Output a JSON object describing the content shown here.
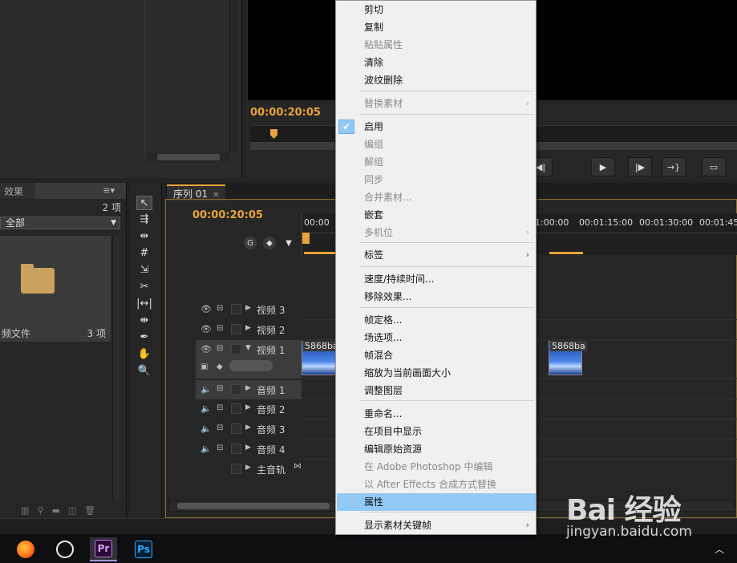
{
  "effects_panel": {
    "tab": "效果",
    "count": "2 项",
    "filter": "全部",
    "bin_name": "频文件",
    "bin_count": "3 项"
  },
  "monitor": {
    "timecode": "00:00:20:05"
  },
  "timeline": {
    "tab": "序列 01",
    "timecode": "00:00:20:05",
    "ruler_ticks": [
      "00:00",
      "1:00:00",
      "00:01:15:00",
      "00:01:30:00",
      "00:01:45:"
    ],
    "tracks": {
      "v3": "视频 3",
      "v2": "视频 2",
      "v1": "视频 1",
      "a1": "音频 1",
      "a2": "音频 2",
      "a3": "音频 3",
      "a4": "音频 4",
      "master": "主音轨"
    },
    "clips": [
      "5868ba",
      "5868ba"
    ]
  },
  "context_menu": {
    "items": [
      {
        "label": "剪切",
        "enabled": true
      },
      {
        "label": "复制",
        "enabled": true
      },
      {
        "label": "粘贴属性",
        "enabled": false
      },
      {
        "label": "清除",
        "enabled": true
      },
      {
        "label": "波纹删除",
        "enabled": true
      },
      {
        "label": "替换素材",
        "enabled": false,
        "submenu": true
      },
      {
        "label": "启用",
        "enabled": true,
        "checked": true
      },
      {
        "label": "编组",
        "enabled": false
      },
      {
        "label": "解组",
        "enabled": false
      },
      {
        "label": "同步",
        "enabled": false
      },
      {
        "label": "合并素材...",
        "enabled": false
      },
      {
        "label": "嵌套",
        "enabled": true
      },
      {
        "label": "多机位",
        "enabled": false,
        "submenu": true
      },
      {
        "label": "标签",
        "enabled": true,
        "submenu": true
      },
      {
        "label": "速度/持续时间...",
        "enabled": true
      },
      {
        "label": "移除效果...",
        "enabled": true
      },
      {
        "label": "帧定格...",
        "enabled": true
      },
      {
        "label": "场选项...",
        "enabled": true
      },
      {
        "label": "帧混合",
        "enabled": true
      },
      {
        "label": "缩放为当前画面大小",
        "enabled": true
      },
      {
        "label": "调整图层",
        "enabled": true
      },
      {
        "label": "重命名...",
        "enabled": true
      },
      {
        "label": "在项目中显示",
        "enabled": true
      },
      {
        "label": "编辑原始资源",
        "enabled": true
      },
      {
        "label": "在 Adobe Photoshop 中编辑",
        "enabled": false
      },
      {
        "label": "以 After Effects 合成方式替换",
        "enabled": false
      },
      {
        "label": "属性",
        "enabled": true,
        "highlighted": true
      },
      {
        "label": "显示素材关键帧",
        "enabled": true,
        "submenu": true
      }
    ]
  },
  "taskbar": {
    "apps": [
      {
        "icon": "firefox-icon"
      },
      {
        "icon": "qq-icon"
      },
      {
        "icon": "premiere-icon",
        "text": "Pr",
        "active": true
      },
      {
        "icon": "photoshop-icon",
        "text": "Ps"
      }
    ]
  },
  "watermark": {
    "brand": "Bai 经验",
    "url": "jingyan.baidu.com"
  },
  "colors": {
    "accent_orange": "#e8a33a",
    "menu_highlight": "#91c9f7",
    "menu_bg": "#f0f0f0"
  }
}
